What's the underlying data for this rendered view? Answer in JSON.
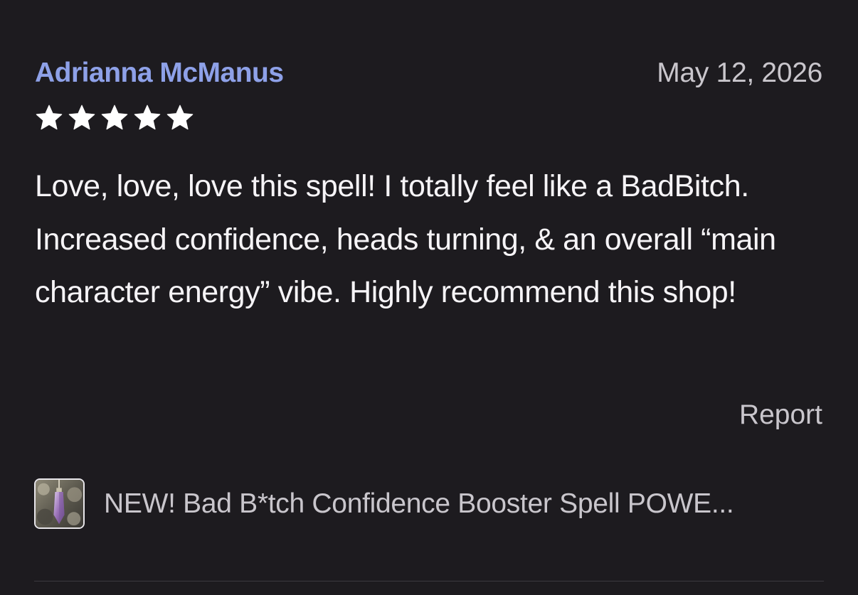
{
  "review": {
    "reviewer_name": "Adrianna McManus",
    "date": "May 12, 2026",
    "rating": 5,
    "rating_max": 5,
    "body": "Love, love, love this spell! I totally feel like a BadBitch. Increased confidence, heads turning, & an overall “main character energy” vibe. Highly recommend this shop!",
    "report_label": "Report"
  },
  "listing": {
    "title": "NEW! Bad B*tch Confidence Booster Spell POWE...",
    "thumbnail_icon": "crystal-pendant-thumbnail"
  },
  "colors": {
    "background": "#1d1b1f",
    "reviewer_name": "#8ea1e8",
    "secondary_text": "#c9c6cc",
    "body_text": "#f6f4f7",
    "star": "#ffffff"
  }
}
